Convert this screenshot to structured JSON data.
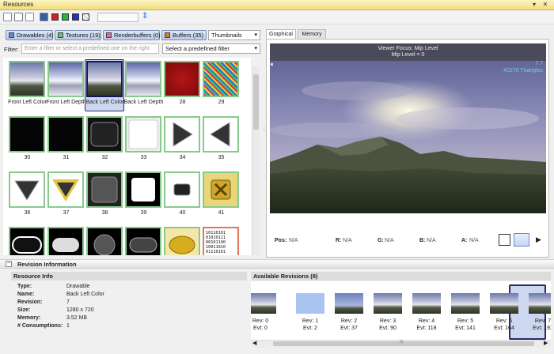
{
  "window": {
    "title": "Resources",
    "pin_glyph": "▾",
    "close_glyph": "✕"
  },
  "filters": {
    "buttons": [
      {
        "label": "Drawables (4)",
        "color": "#5b8dd6"
      },
      {
        "label": "Textures (19)",
        "color": "#6cc36c"
      },
      {
        "label": "Renderbuffers (0)",
        "color": "#e36b9b"
      },
      {
        "label": "Buffers (35)",
        "color": "#d27b30"
      }
    ],
    "view_mode": "Thumbnails",
    "filter_label": "Filter:",
    "filter_placeholder": "Enter a filter or select a predefined one on the right",
    "predefined_placeholder": "Select a predefined filter"
  },
  "resources": [
    {
      "label": "Front Left Color",
      "kind": "sky",
      "border": "green"
    },
    {
      "label": "Front Left Depth",
      "kind": "skydepth",
      "border": "green"
    },
    {
      "label": "Back Left Color",
      "kind": "sky",
      "border": "selected"
    },
    {
      "label": "Back Left Depth",
      "kind": "skydepth",
      "border": "green"
    },
    {
      "label": "28",
      "kind": "red",
      "border": "green"
    },
    {
      "label": "29",
      "kind": "noise",
      "border": "green"
    },
    {
      "label": "30",
      "kind": "black",
      "border": "green"
    },
    {
      "label": "31",
      "kind": "black",
      "border": "green"
    },
    {
      "label": "32",
      "kind": "blackround",
      "border": "green"
    },
    {
      "label": "33",
      "kind": "white",
      "border": "green"
    },
    {
      "label": "34",
      "kind": "arrowright",
      "border": "green"
    },
    {
      "label": "35",
      "kind": "arrowleft",
      "border": "green"
    },
    {
      "label": "36",
      "kind": "arrowdown",
      "border": "green"
    },
    {
      "label": "37",
      "kind": "arrowdowngold",
      "border": "green"
    },
    {
      "label": "38",
      "kind": "darkbtn",
      "border": "green"
    },
    {
      "label": "39",
      "kind": "glow",
      "border": "green"
    },
    {
      "label": "40",
      "kind": "smallbtn",
      "border": "green"
    },
    {
      "label": "41",
      "kind": "goldx",
      "border": "green"
    },
    {
      "label": "",
      "kind": "pill",
      "border": "green"
    },
    {
      "label": "",
      "kind": "pillgrad",
      "border": "green"
    },
    {
      "label": "",
      "kind": "sphere",
      "border": "green"
    },
    {
      "label": "",
      "kind": "darkpill",
      "border": "green"
    },
    {
      "label": "",
      "kind": "goldpill",
      "border": "green"
    },
    {
      "label": "",
      "kind": "binary",
      "border": "red",
      "binary_text": "10110101\n01010111\n00101100\n10011010\n01110101"
    }
  ],
  "viewer": {
    "tabs": [
      "Graphical",
      "Memory"
    ],
    "focus_line": "Viewer Focus: Mip Level",
    "mip_line": "Mip Level = 0",
    "stat1": "7.7",
    "stat2": "40270 Triangles",
    "pixel": [
      {
        "key": "Pos:",
        "value": "N/A"
      },
      {
        "key": "R:",
        "value": "N/A"
      },
      {
        "key": "G:",
        "value": "N/A"
      },
      {
        "key": "B:",
        "value": "N/A"
      },
      {
        "key": "A:",
        "value": "N/A"
      }
    ]
  },
  "revision_panel": {
    "title": "Revision Information",
    "resource_info_title": "Resource Info",
    "info": [
      {
        "key": "Type:",
        "value": "Drawable"
      },
      {
        "key": "Name:",
        "value": "Back Left Color"
      },
      {
        "key": "Revision:",
        "value": "7"
      },
      {
        "key": "Size:",
        "value": "1280 x 720"
      },
      {
        "key": "Memory:",
        "value": "3.52 MB"
      },
      {
        "key": "# Consumptions:",
        "value": "1"
      }
    ],
    "available_title": "Available Revisions (8)",
    "revisions": [
      {
        "rev": "Rev: 0",
        "evt": "Evt: 0",
        "kind": "sky"
      },
      {
        "rev": "Rev: 1",
        "evt": "Evt: 2",
        "kind": "blue"
      },
      {
        "rev": "Rev: 2",
        "evt": "Evt: 37",
        "kind": "skyflat"
      },
      {
        "rev": "Rev: 3",
        "evt": "Evt: 90",
        "kind": "sky"
      },
      {
        "rev": "Rev: 4",
        "evt": "Evt: 118",
        "kind": "sky"
      },
      {
        "rev": "Rev: 5",
        "evt": "Evt: 141",
        "kind": "sky"
      },
      {
        "rev": "Rev: 6",
        "evt": "Evt: 164",
        "kind": "sky"
      },
      {
        "rev": "Rev: 7",
        "evt": "Evt: 192",
        "kind": "sky"
      }
    ],
    "scroll_label": "III"
  }
}
